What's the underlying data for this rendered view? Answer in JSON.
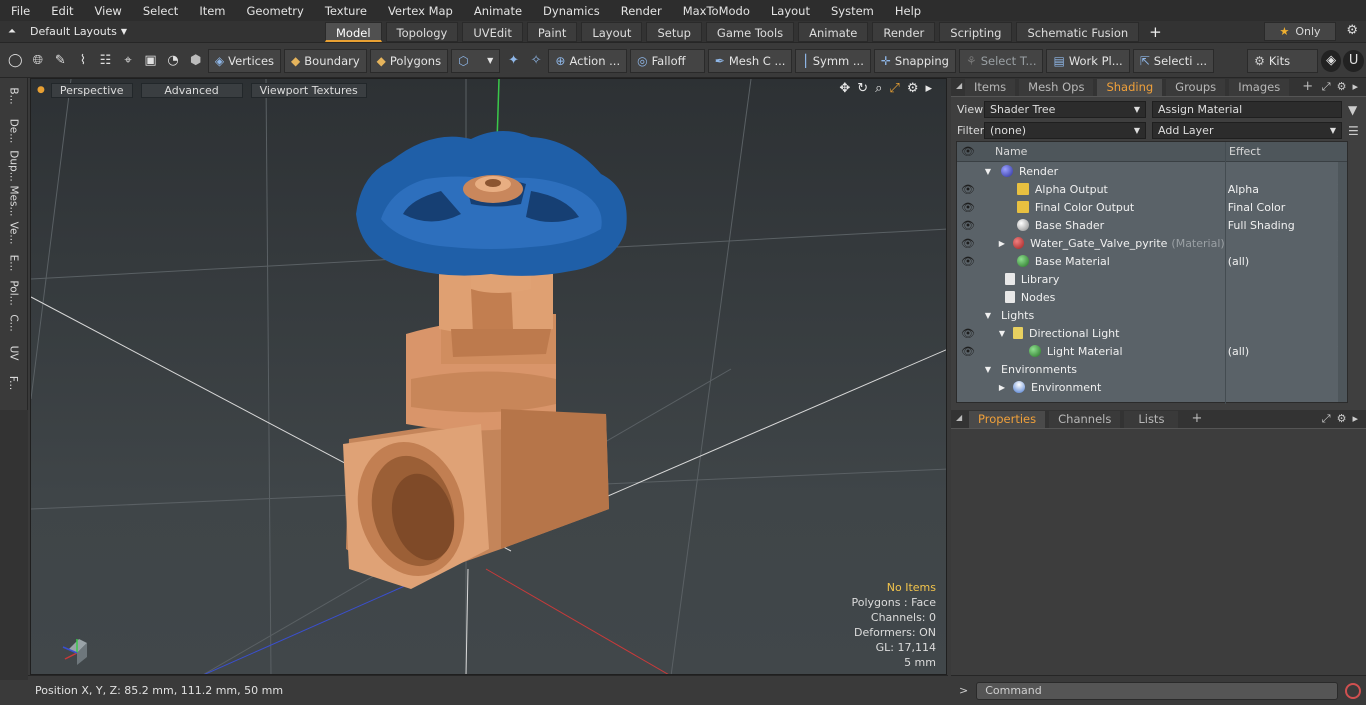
{
  "menu": [
    "File",
    "Edit",
    "View",
    "Select",
    "Item",
    "Geometry",
    "Texture",
    "Vertex Map",
    "Animate",
    "Dynamics",
    "Render",
    "MaxToModo",
    "Layout",
    "System",
    "Help"
  ],
  "layout": {
    "selector": "Default Layouts",
    "tabs": [
      "Model",
      "Topology",
      "UVEdit",
      "Paint",
      "Layout",
      "Setup",
      "Game Tools",
      "Animate",
      "Render",
      "Scripting",
      "Schematic Fusion"
    ],
    "active_tab": "Model",
    "only_label": "Only"
  },
  "toolbar": {
    "vertices": "Vertices",
    "boundary": "Boundary",
    "polygons": "Polygons",
    "action": "Action ...",
    "falloff": "Falloff",
    "mesh": "Mesh C ...",
    "symm": "Symm ...",
    "snapping": "Snapping",
    "select_t": "Select T...",
    "workplane": "Work Pl...",
    "selecti": "Selecti ...",
    "kits": "Kits"
  },
  "left_strip": [
    "B...",
    "De...",
    "Dup...",
    "Mes...",
    "Ve...",
    "E...",
    "Pol...",
    "C...",
    "UV",
    "F..."
  ],
  "viewport": {
    "perspective": "Perspective",
    "advanced": "Advanced",
    "textures": "Viewport Textures",
    "info": {
      "no_items": "No Items",
      "polygons": "Polygons : Face",
      "channels": "Channels: 0",
      "deformers": "Deformers: ON",
      "gl": "GL: 17,114",
      "unit": "5 mm"
    }
  },
  "status": {
    "position": "Position X, Y, Z:  85.2 mm, 111.2 mm, 50 mm"
  },
  "right": {
    "tabs": [
      "Items",
      "Mesh Ops",
      "Shading",
      "Groups",
      "Images"
    ],
    "active": "Shading",
    "view_label": "View",
    "view_value": "Shader Tree",
    "assign": "Assign Material",
    "filter_label": "Filter",
    "filter_value": "(none)",
    "add_layer": "Add Layer",
    "col_name": "Name",
    "col_effect": "Effect",
    "rows": [
      {
        "name": "Render",
        "effect": ""
      },
      {
        "name": "Alpha Output",
        "effect": "Alpha"
      },
      {
        "name": "Final Color Output",
        "effect": "Final Color"
      },
      {
        "name": "Base Shader",
        "effect": "Full Shading"
      },
      {
        "name": "Water_Gate_Valve_pyrite",
        "suffix": "(Material)",
        "effect": ""
      },
      {
        "name": "Base Material",
        "effect": "(all)"
      },
      {
        "name": "Library",
        "effect": ""
      },
      {
        "name": "Nodes",
        "effect": ""
      },
      {
        "name": "Lights",
        "effect": ""
      },
      {
        "name": "Directional Light",
        "effect": ""
      },
      {
        "name": "Light Material",
        "effect": "(all)"
      },
      {
        "name": "Environments",
        "effect": ""
      },
      {
        "name": "Environment",
        "effect": ""
      }
    ],
    "props_tabs": [
      "Properties",
      "Channels",
      "Lists"
    ],
    "props_active": "Properties",
    "command": "Command"
  },
  "colors": {
    "accent": "#e8a033",
    "valve_handle": "#1f5fa8",
    "valve_body": "#d9956a"
  }
}
